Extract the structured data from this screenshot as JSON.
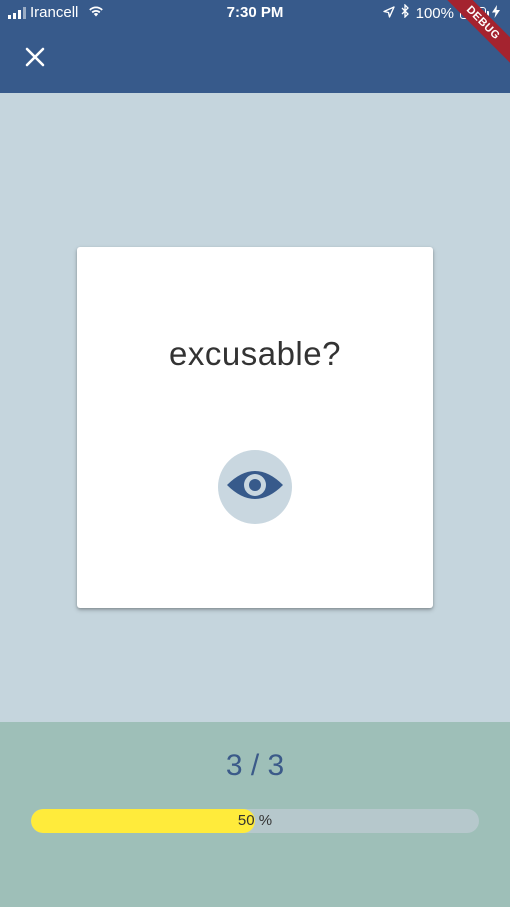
{
  "status_bar": {
    "carrier": "Irancell",
    "time": "7:30 PM",
    "battery": "100%",
    "signal_icon": "signal-bars-icon",
    "wifi_icon": "wifi-icon",
    "location_icon": "location-arrow-icon",
    "bluetooth_icon": "bluetooth-icon",
    "battery_icon": "battery-icon",
    "charging_icon": "charging-bolt-icon"
  },
  "debug_banner": "DEBUG",
  "app_bar": {
    "close_icon": "close-icon",
    "color": "#375a8b"
  },
  "card": {
    "word": "excusable?",
    "reveal_icon": "eye-icon"
  },
  "progress": {
    "counter": "3 / 3",
    "percent_label": "50 %",
    "value": 0.5,
    "fill_color": "#ffeb3b",
    "track_color": "#b6c8cc"
  },
  "colors": {
    "background": "#c5d5dd",
    "bottom_panel": "#9ebfb8",
    "accent": "#375a8b"
  }
}
